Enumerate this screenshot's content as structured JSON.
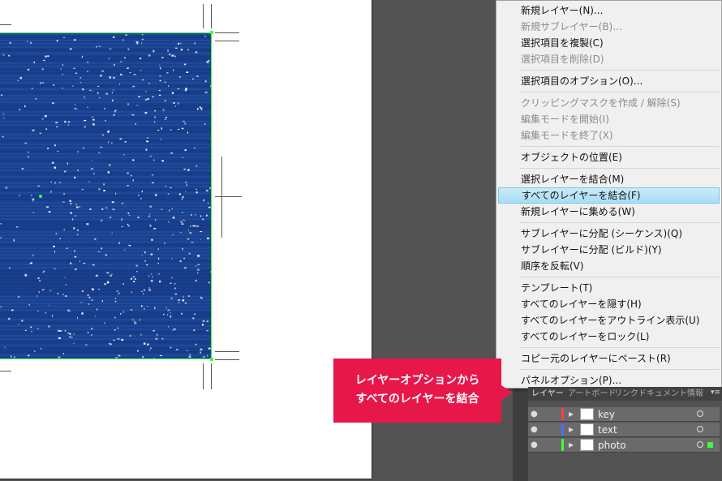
{
  "menu": {
    "items": [
      {
        "label": "新規レイヤー(N)...",
        "state": "enabled"
      },
      {
        "label": "新規サブレイヤー(B)...",
        "state": "disabled"
      },
      {
        "label": "選択項目を複製(C)",
        "state": "enabled"
      },
      {
        "label": "選択項目を削除(D)",
        "state": "disabled"
      },
      {
        "sep": true
      },
      {
        "label": "選択項目のオプション(O)...",
        "state": "enabled"
      },
      {
        "sep": true
      },
      {
        "label": "クリッピングマスクを作成 / 解除(S)",
        "state": "disabled"
      },
      {
        "label": "編集モードを開始(I)",
        "state": "disabled"
      },
      {
        "label": "編集モードを終了(X)",
        "state": "disabled"
      },
      {
        "sep": true
      },
      {
        "label": "オブジェクトの位置(E)",
        "state": "enabled"
      },
      {
        "sep": true
      },
      {
        "label": "選択レイヤーを結合(M)",
        "state": "enabled"
      },
      {
        "label": "すべてのレイヤーを結合(F)",
        "state": "highlighted"
      },
      {
        "label": "新規レイヤーに集める(W)",
        "state": "enabled"
      },
      {
        "sep": true
      },
      {
        "label": "サブレイヤーに分配 (シーケンス)(Q)",
        "state": "enabled"
      },
      {
        "label": "サブレイヤーに分配 (ビルド)(Y)",
        "state": "enabled"
      },
      {
        "label": "順序を反転(V)",
        "state": "enabled"
      },
      {
        "sep": true
      },
      {
        "label": "テンプレート(T)",
        "state": "enabled"
      },
      {
        "label": "すべてのレイヤーを隠す(H)",
        "state": "enabled"
      },
      {
        "label": "すべてのレイヤーをアウトライン表示(U)",
        "state": "enabled"
      },
      {
        "label": "すべてのレイヤーをロック(L)",
        "state": "enabled"
      },
      {
        "sep": true
      },
      {
        "label": "コピー元のレイヤーにペースト(R)",
        "state": "enabled"
      },
      {
        "sep": true
      },
      {
        "label": "パネルオプション(P)...",
        "state": "enabled"
      }
    ]
  },
  "callout": {
    "line1": "レイヤーオプションから",
    "line2": "すべてのレイヤーを結合",
    "color": "#e8174a"
  },
  "layers_panel": {
    "tabs": [
      "レイヤー",
      "アートボード",
      "リンク",
      "ドキュメント情報"
    ],
    "active_tab": "レイヤー",
    "menu_icon": "panel-menu-icon",
    "layers": [
      {
        "name": "key",
        "color": "#ff4040"
      },
      {
        "name": "text",
        "color": "#4a6cff"
      },
      {
        "name": "photo",
        "color": "#3cff3c"
      }
    ]
  },
  "colors": {
    "selection": "#3cff3c",
    "highlight": "#a8def4"
  }
}
